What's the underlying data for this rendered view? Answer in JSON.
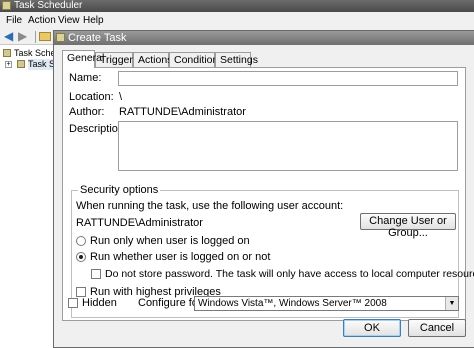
{
  "background_window": {
    "title": "Task Scheduler",
    "menu": [
      "File",
      "Action",
      "View",
      "Help"
    ],
    "toolbar": {
      "back_icon": "arrow-left-icon",
      "forward_icon": "arrow-right-icon",
      "folder_icon": "folder-icon"
    },
    "tree": [
      {
        "label": "Task Schedu",
        "icon": "task-scheduler-icon"
      },
      {
        "label": "Task Sc",
        "icon": "task-library-icon"
      }
    ]
  },
  "dialog": {
    "title": "Create Task",
    "tabs": [
      "General",
      "Triggers",
      "Actions",
      "Conditions",
      "Settings"
    ],
    "active_tab": "General",
    "general": {
      "name_label": "Name:",
      "name_value": "",
      "location_label": "Location:",
      "location_value": "\\",
      "author_label": "Author:",
      "author_value": "RATTUNDE\\Administrator",
      "description_label": "Description:",
      "description_value": ""
    },
    "security": {
      "legend": "Security options",
      "account_prompt": "When running the task, use the following user account:",
      "account": "RATTUNDE\\Administrator",
      "change_button": "Change User or Group...",
      "radio_logged_on": "Run only when user is logged on",
      "radio_logged_on_or_not": "Run whether user is logged on or not",
      "selected_radio": "Run whether user is logged on or not",
      "no_store_password": "Do not store password.  The task will only have access to local computer resources.",
      "no_store_password_checked": false,
      "highest_privileges": "Run with highest privileges",
      "highest_privileges_checked": false
    },
    "hidden_label": "Hidden",
    "hidden_checked": false,
    "configure_label": "Configure for:",
    "configure_value": "Windows Vista™, Windows Server™ 2008",
    "ok_button": "OK",
    "cancel_button": "Cancel"
  }
}
